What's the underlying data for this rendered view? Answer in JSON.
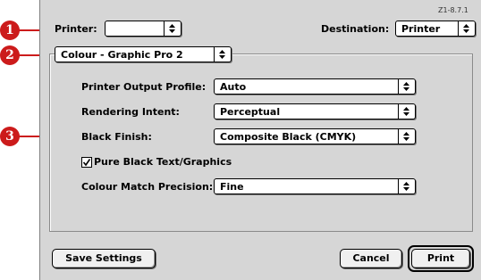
{
  "callouts": [
    "1",
    "2",
    "3"
  ],
  "version": "Z1-8.7.1",
  "printer": {
    "label": "Printer:",
    "value": ""
  },
  "destination": {
    "label": "Destination:",
    "value": "Printer"
  },
  "panel": {
    "value": "Colour - Graphic Pro 2"
  },
  "fields": {
    "output_profile": {
      "label": "Printer Output Profile:",
      "value": "Auto"
    },
    "rendering_intent": {
      "label": "Rendering Intent:",
      "value": "Perceptual"
    },
    "black_finish": {
      "label": "Black Finish:",
      "value": "Composite Black (CMYK)"
    },
    "pure_black": {
      "label": "Pure Black Text/Graphics",
      "checked": true
    },
    "match_precision": {
      "label": "Colour Match Precision:",
      "value": "Fine"
    }
  },
  "buttons": {
    "save": "Save Settings",
    "cancel": "Cancel",
    "print": "Print"
  },
  "colors": {
    "callout": "#cc1b1b",
    "dialog_bg": "#d6d6d6"
  },
  "icons": {
    "popup_arrow": "updown-arrows-icon",
    "checkbox": "checkmark-icon"
  }
}
